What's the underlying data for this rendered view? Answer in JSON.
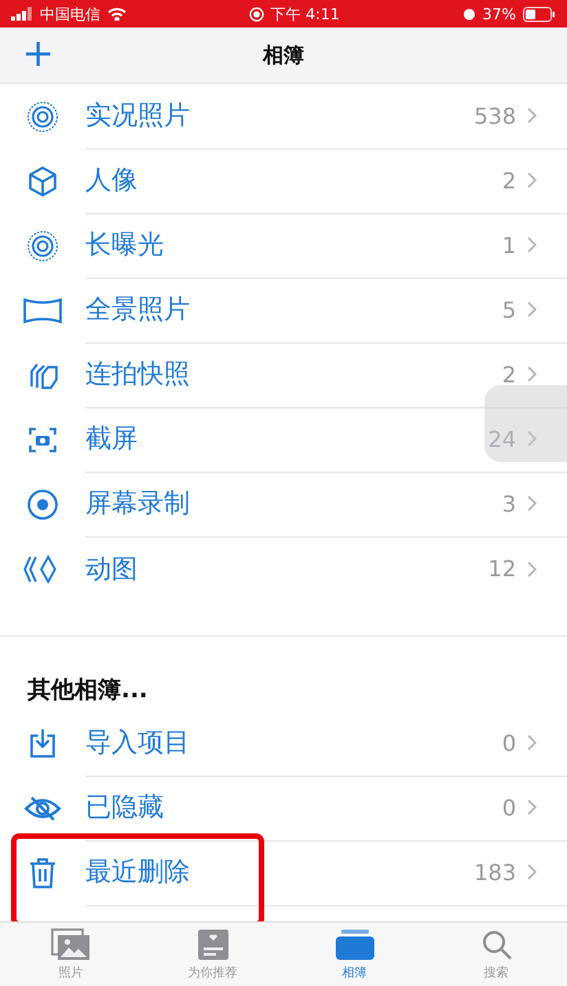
{
  "status_bar": {
    "carrier": "中国电信",
    "time": "下午 4:11",
    "battery": "37%"
  },
  "nav": {
    "title": "相簿",
    "add_button": "+"
  },
  "media_types": [
    {
      "label": "实况照片",
      "count": "538",
      "kind": "live"
    },
    {
      "label": "人像",
      "count": "2",
      "kind": "cube"
    },
    {
      "label": "长曝光",
      "count": "1",
      "kind": "live"
    },
    {
      "label": "全景照片",
      "count": "5",
      "kind": "pano"
    },
    {
      "label": "连拍快照",
      "count": "2",
      "kind": "burst"
    },
    {
      "label": "截屏",
      "count": "24",
      "kind": "screenshot"
    },
    {
      "label": "屏幕录制",
      "count": "3",
      "kind": "record"
    },
    {
      "label": "动图",
      "count": "12",
      "kind": "animated"
    }
  ],
  "other_albums": {
    "title": "其他相簿...",
    "items": [
      {
        "label": "导入项目",
        "count": "0",
        "kind": "import",
        "highlighted": false
      },
      {
        "label": "已隐藏",
        "count": "0",
        "kind": "hidden",
        "highlighted": false
      },
      {
        "label": "最近删除",
        "count": "183",
        "kind": "trash",
        "highlighted": true
      }
    ]
  },
  "tab_bar": [
    {
      "label": "照片",
      "kind": "photos",
      "selected": false
    },
    {
      "label": "为你推荐",
      "kind": "foryou",
      "selected": false
    },
    {
      "label": "相簿",
      "kind": "albums",
      "selected": true
    },
    {
      "label": "搜索",
      "kind": "search",
      "selected": false
    }
  ]
}
